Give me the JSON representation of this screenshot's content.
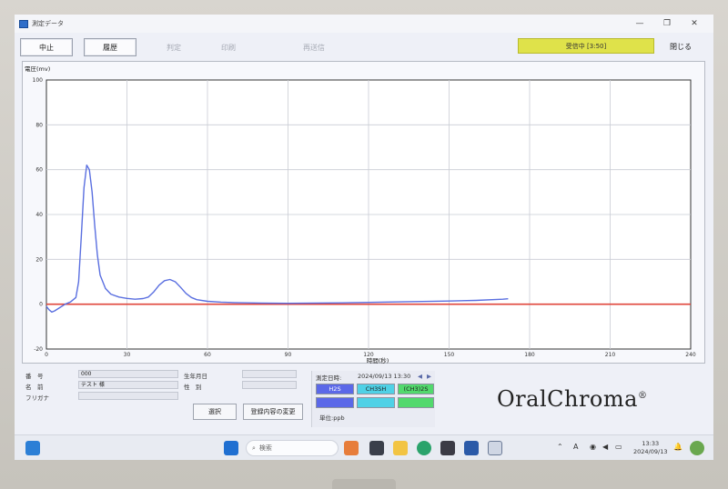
{
  "window": {
    "title": "測定データ"
  },
  "toolbar": {
    "stop": "中止",
    "history": "履歴",
    "judge": "判定",
    "print": "印刷",
    "resend": "再送信",
    "status": "受信中 [3:50]",
    "close": "閉じる"
  },
  "chart_data": {
    "type": "line",
    "ylabel": "電圧(mv)",
    "xlabel": "時間(秒)",
    "xlim": [
      0,
      240
    ],
    "ylim": [
      -20,
      100
    ],
    "xticks": [
      0,
      30,
      60,
      90,
      120,
      150,
      180,
      210,
      240
    ],
    "yticks": [
      -20,
      0,
      20,
      40,
      60,
      80,
      100
    ],
    "baseline": {
      "y": 0,
      "color": "#e0443a"
    },
    "series": [
      {
        "color": "#5a6fe0",
        "x": [
          0,
          1,
          2,
          3,
          5,
          7,
          9,
          11,
          12,
          13,
          14,
          15,
          16,
          17,
          18,
          19,
          20,
          22,
          24,
          27,
          30,
          33,
          36,
          38,
          40,
          42,
          44,
          46,
          48,
          50,
          52,
          54,
          56,
          60,
          65,
          70,
          80,
          90,
          100,
          110,
          120,
          130,
          140,
          150,
          160,
          170,
          172
        ],
        "y": [
          -1,
          -2.5,
          -3.5,
          -3,
          -1.5,
          0,
          1,
          3,
          10,
          30,
          52,
          62,
          60,
          50,
          35,
          22,
          13,
          7,
          4.5,
          3.2,
          2.6,
          2.2,
          2.5,
          3.2,
          5.5,
          8.5,
          10.5,
          11,
          10,
          7.5,
          4.8,
          3,
          2,
          1.3,
          0.9,
          0.7,
          0.5,
          0.4,
          0.5,
          0.6,
          0.8,
          1.0,
          1.2,
          1.4,
          1.7,
          2.2,
          2.4
        ]
      }
    ]
  },
  "patient": {
    "number_label": "番　号",
    "number_value": "000",
    "name_label": "名　前",
    "name_value": "テスト 様",
    "furigana_label": "フリガナ",
    "furigana_value": "",
    "birth_label": "生年月日",
    "birth_value": "",
    "sex_label": "性　別",
    "sex_value": ""
  },
  "actions": {
    "select": "選択",
    "change": "登録内容の変更"
  },
  "measurement": {
    "date_label": "測定日時:",
    "date_value": "2024/09/13 13:30",
    "prev": "◀",
    "next": "▶",
    "gases": [
      {
        "name": "H2S",
        "value": "",
        "color": "#5b68e8"
      },
      {
        "name": "CH3SH",
        "value": "",
        "color": "#4fd1e6"
      },
      {
        "name": "(CH3)2S",
        "value": "",
        "color": "#52d96d"
      }
    ],
    "unit": "単位:ppb"
  },
  "logo": {
    "text": "OralChroma",
    "mark": "®"
  },
  "taskbar": {
    "search_placeholder": "検索",
    "time": "13:33",
    "date": "2024/09/13",
    "ime": "A"
  }
}
